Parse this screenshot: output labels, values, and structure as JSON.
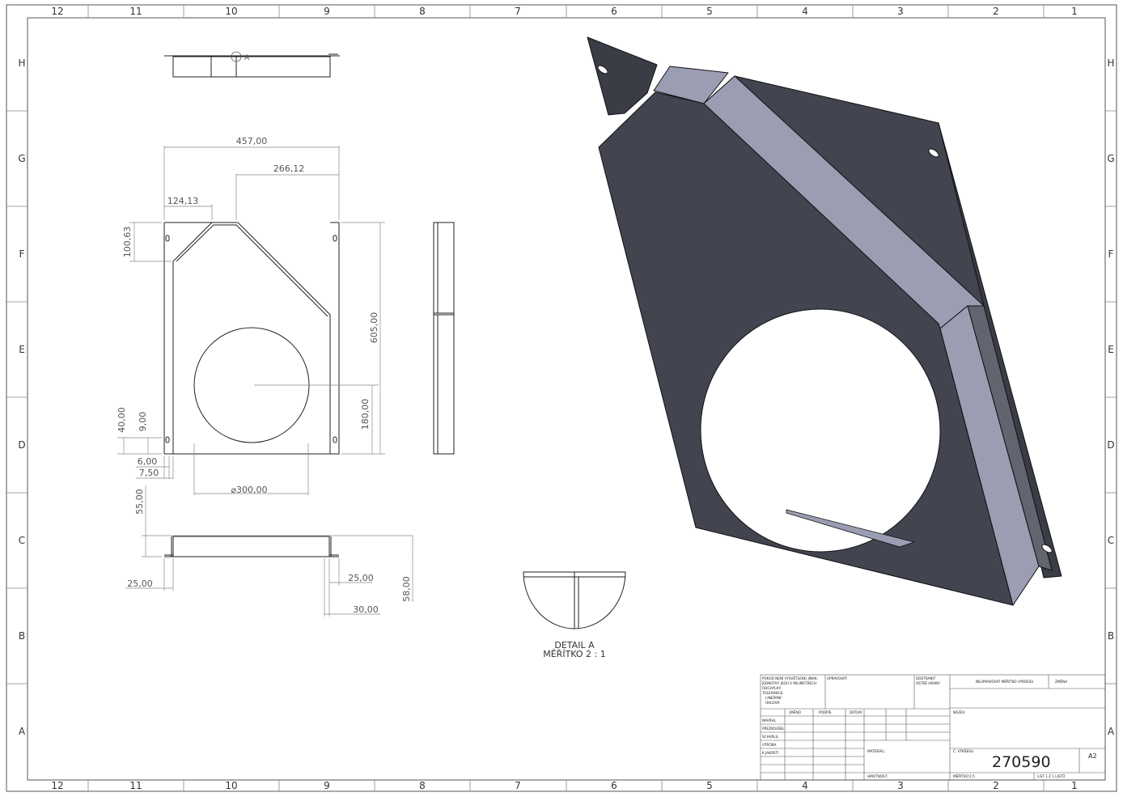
{
  "zones": {
    "columns": [
      "12",
      "11",
      "10",
      "9",
      "8",
      "7",
      "6",
      "5",
      "4",
      "3",
      "2",
      "1"
    ],
    "rows": [
      "H",
      "G",
      "F",
      "E",
      "D",
      "C",
      "B",
      "A"
    ]
  },
  "dimensions": {
    "width_total": "457,00",
    "width_right": "266,12",
    "width_left": "124,13",
    "chamfer_height": "100,63",
    "height_total": "605,00",
    "hole_center_height": "180,00",
    "slot_height": "40,00",
    "slot_offset": "9,00",
    "edge_a": "6,00",
    "edge_b": "7,50",
    "hole_diameter": "⌀300,00",
    "bottom_flange_height": "55,00",
    "flange_left": "25,00",
    "flange_right_a": "25,00",
    "flange_right_b": "30,00",
    "bottom_height": "58,00"
  },
  "section_marker": "A",
  "detail": {
    "title": "DETAIL A",
    "scale": "MĚŘÍTKO 2 : 1"
  },
  "title_block": {
    "notes": [
      "POKUD NENÍ VYSVĚTLENO JINAK:",
      "JEDNOTKY JSOU V MILIMETRECH",
      "ODCHYLKY:",
      "TOLERANCE:",
      "LINEÁRNÍ:",
      "ÚHLOVÁ:"
    ],
    "finish_label": "UPRAVOVAT:",
    "deburr": [
      "ODSTRANIT",
      "OSTRÉ HRANY"
    ],
    "scale_note": "NEUPRAVOVAT MĚŘÍTKO VÝKRESU",
    "revision": "ZMĚNA",
    "col_name": "JMÉNO",
    "col_sign": "PODPIS",
    "col_date": "DATUM",
    "title_label": "NÁZEV:",
    "rows": [
      "NAVRHL",
      "PŘEZKOUŠEL",
      "SCHVÁLIL",
      "VÝROBA",
      "K JAKOSTI"
    ],
    "material_label": "MATERIÁL:",
    "drawing_no_label": "Č. VÝKRESU",
    "drawing_no": "270590",
    "size": "A2",
    "weight_label": "HMOTNOST:",
    "scale_label": "MĚŘÍTKO:1:5",
    "sheet_label": "LIST 1 Z 1 LISTŮ"
  },
  "colors": {
    "plate": "#42444f",
    "flange": "#9b9db3",
    "flange_dark": "#62646f",
    "line": "#222222",
    "dim": "#888888"
  }
}
